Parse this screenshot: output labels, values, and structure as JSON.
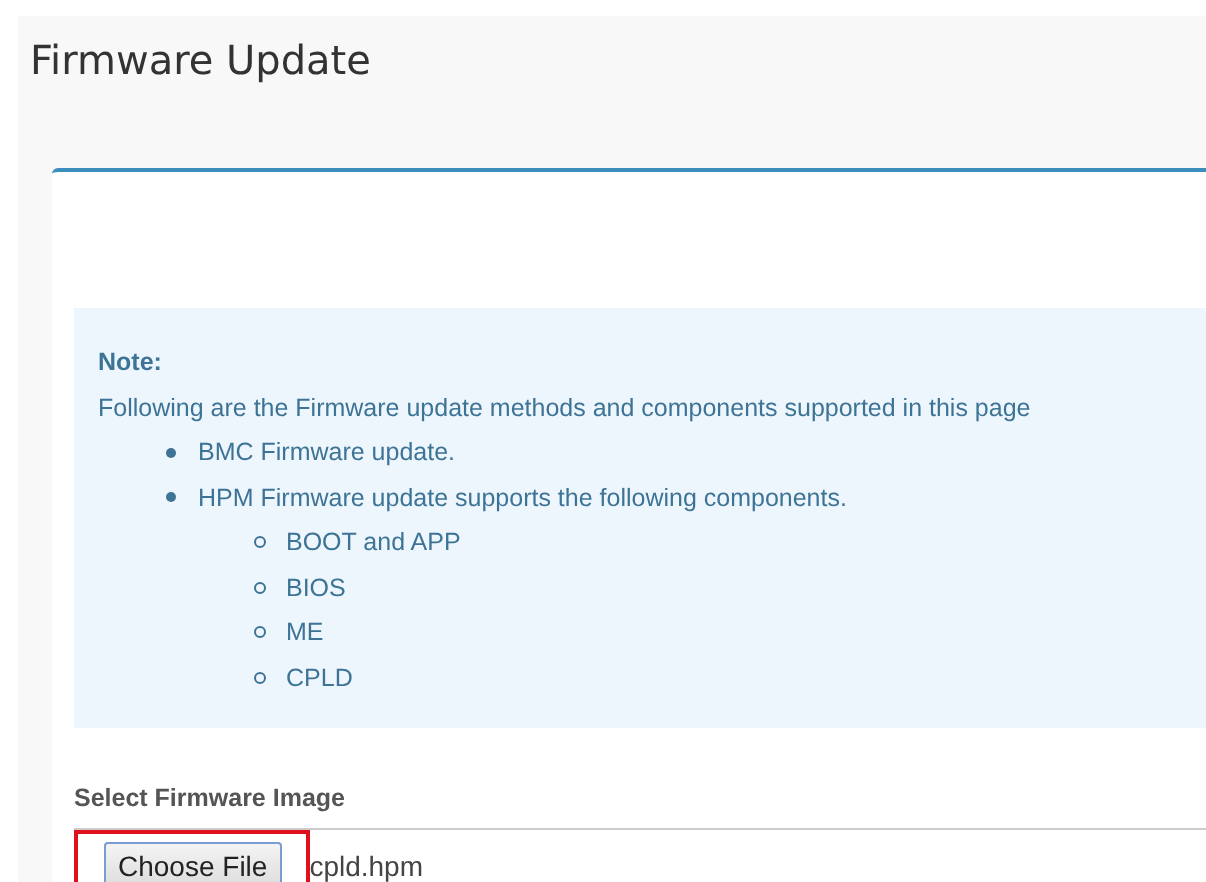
{
  "page_title": "Firmware Update",
  "note": {
    "heading": "Note:",
    "intro": "Following are the Firmware update methods and components supported in this page",
    "items": [
      {
        "text": "BMC Firmware update."
      },
      {
        "text": "HPM Firmware update supports the following components.",
        "children": [
          {
            "text": "BOOT and APP"
          },
          {
            "text": "BIOS"
          },
          {
            "text": "ME"
          },
          {
            "text": "CPLD"
          }
        ]
      }
    ]
  },
  "file_section": {
    "label": "Select Firmware Image",
    "button": "Choose File",
    "file_name": "cpld.hpm",
    "highlighted": true
  }
}
